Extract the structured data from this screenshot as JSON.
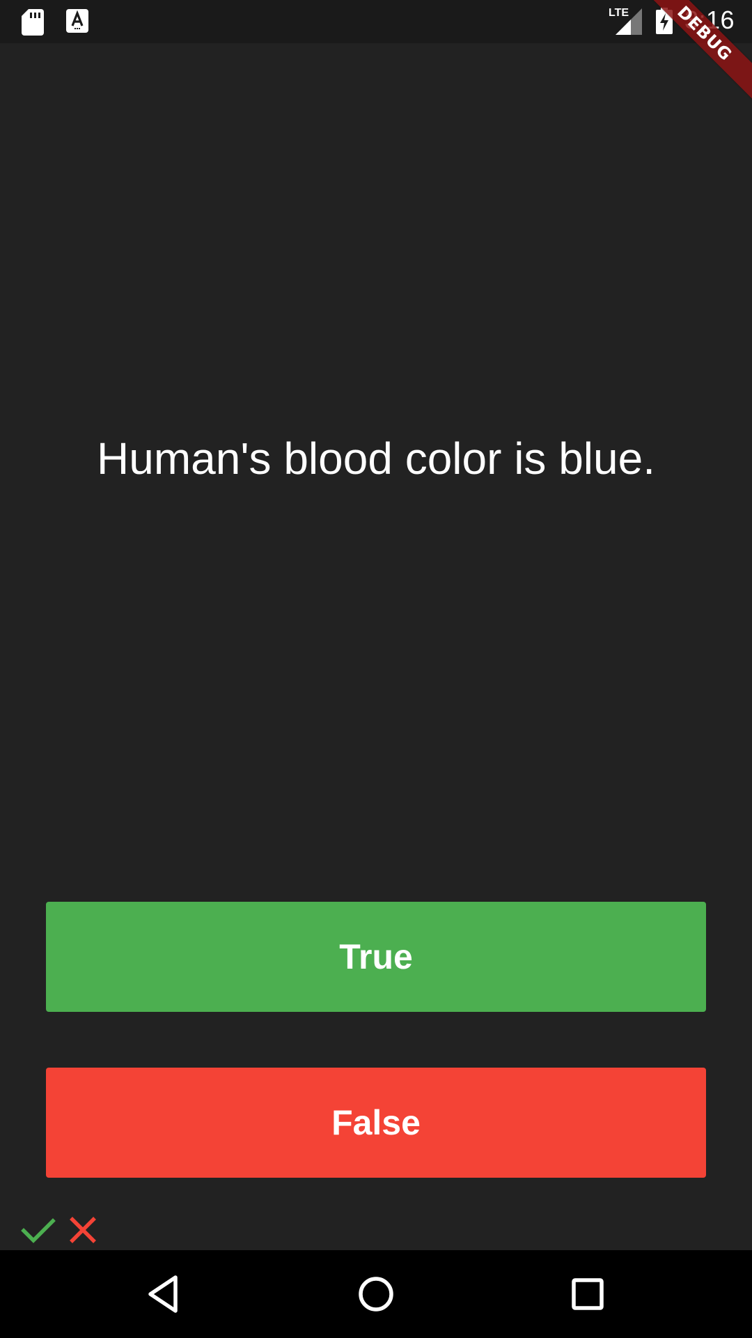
{
  "status_bar": {
    "time": "3:16",
    "network_label": "LTE",
    "icons": [
      "sd-card-icon",
      "text-a-icon",
      "signal-icon",
      "battery-charging-icon"
    ]
  },
  "debug_banner": "DEBUG",
  "question": "Human's blood color is blue.",
  "answers": {
    "true_label": "True",
    "false_label": "False"
  },
  "score_keeper": [
    "check-icon",
    "close-icon"
  ],
  "navigation": [
    "back-icon",
    "home-icon",
    "recents-icon"
  ],
  "colors": {
    "background": "#222222",
    "true_button": "#4caf50",
    "false_button": "#f44336",
    "check": "#4caf50",
    "cross": "#f44336"
  }
}
